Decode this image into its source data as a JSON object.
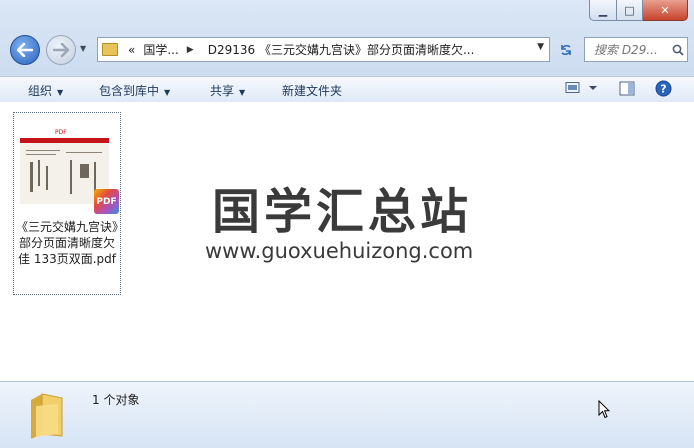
{
  "window": {
    "minimize": "▁",
    "maximize": "□",
    "close": "✕"
  },
  "nav": {
    "back_icon": "arrow-left",
    "forward_icon": "arrow-right"
  },
  "address": {
    "prefix": "«",
    "crumb1": "国学...",
    "crumb2": "D29136 《三元交媾九宫诀》部分页面清晰度欠..."
  },
  "search": {
    "placeholder": "搜索 D29..."
  },
  "toolbar": {
    "organize": "组织",
    "include_library": "包含到库中",
    "share": "共享",
    "new_folder": "新建文件夹"
  },
  "file": {
    "name": "《三元交媾九宫诀》部分页面清晰度欠佳 133页双面.pdf",
    "icon_label": "PDF",
    "thumb_tag": "PDF"
  },
  "watermark": {
    "title": "国学汇总站",
    "url": "www.guoxuehuizong.com"
  },
  "details": {
    "count": "1 个对象"
  }
}
